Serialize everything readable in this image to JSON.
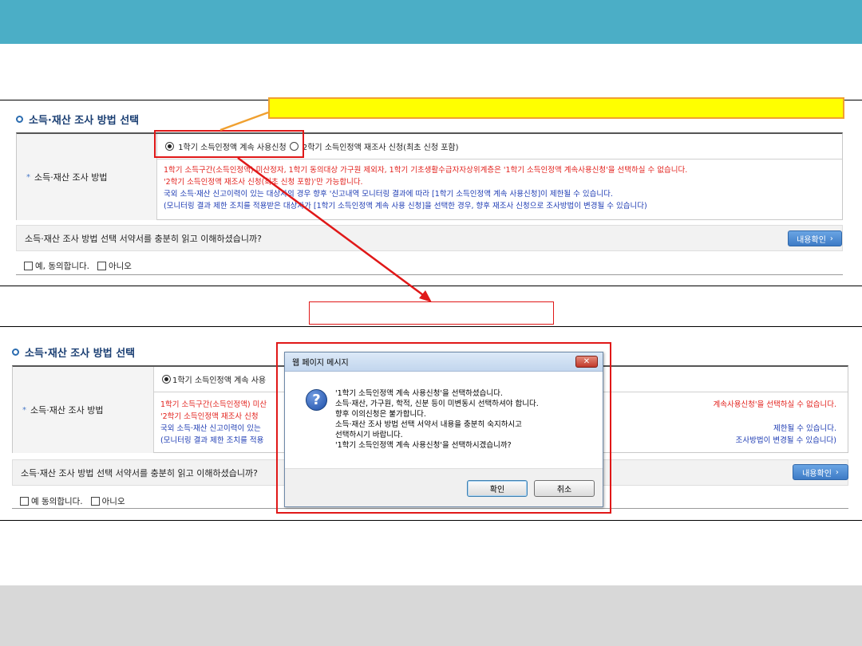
{
  "section_title": "소득·재산 조사 방법 선택",
  "method_label": "소득·재산 조사 방법",
  "radio_option_1": "1학기 소득인정액 계속 사용신청",
  "radio_option_2": "2학기 소득인정액 재조사 신청(최초 신청 포함)",
  "notes": {
    "line1": "1학기 소득구간(소득인정액) 미산정자, 1학기 동의대상 가구원 제외자, 1학기 기초생활수급자자상위계층은 '1학기 소득인정액 계속사용신청'을 선택하실 수 없습니다.",
    "line2": "'2학기 소득인정액 재조사 신청(최초 신청 포함)'만 가능합니다.",
    "line3": "국외 소득·재산 신고이력이 있는 대상자의 경우 향후 '신고내역 모니터링 결과에 따라 [1학기 소득인정액 계속 사용신청]이 제한될 수 있습니다.",
    "line4": "(모니터링 결과 제한 조치를 적용받은 대상자가 [1학기 소득인정액 계속 사용 신청]을 선택한 경우, 향후 재조사 신청으로 조사방법이 변경될 수 있습니다)"
  },
  "agree_question": "소득·재산 조사 방법 선택 서약서를 충분히 읽고 이해하셨습니까?",
  "confirm_button": "내용확인",
  "agree_yes": "예, 동의합니다.",
  "agree_no": "아니오",
  "lower": {
    "radio_option_1_partial": "1학기 소득인정액 계속 사용",
    "note1_left": "1학기 소득구간(소득인정액) 미산",
    "note1_right": "계속사용신청'을 선택하실 수 없습니다.",
    "note2_left": "'2학기 소득인정액 재조사 신청",
    "note3_left": "국외 소득·재산 신고이력이 있는",
    "note3_right": "제한될 수 있습니다.",
    "note4_left": "(모니터링 결과 제한 조치를 적용",
    "note4_right": "조사방법이 변경될 수 있습니다)",
    "agree_question_partial": "소득·재산 조사 방법 선택 서약서를 충분히 읽고 이해하셨습니까?",
    "agree_yes": "예 동의합니다.",
    "agree_no": "아니오"
  },
  "dialog": {
    "title": "웹 페이지 메시지",
    "close_glyph": "✕",
    "icon_glyph": "?",
    "lines": [
      "'1학기 소득인정액 계속 사용신청'을 선택하셨습니다.",
      "소득·재산, 가구원, 학적, 신분 등이 미변동시 선택하셔야 합니다.",
      "향후 이의신청은 불가합니다.",
      "소득·재산 조사 방법 선택 서약서 내용을 충분히 숙지하시고",
      "선택하시기 바랍니다.",
      "'1학기 소득인정액 계속 사용신청'을 선택하시겠습니까?"
    ],
    "ok_label": "확인",
    "cancel_label": "취소"
  },
  "callout_text": "",
  "lower_callout_text": "",
  "colors": {
    "header_band": "#4baec6",
    "callout_fill": "#ffff00",
    "highlight_red": "#e01818",
    "note_red": "#e2211c",
    "note_blue": "#1d3bb3"
  }
}
